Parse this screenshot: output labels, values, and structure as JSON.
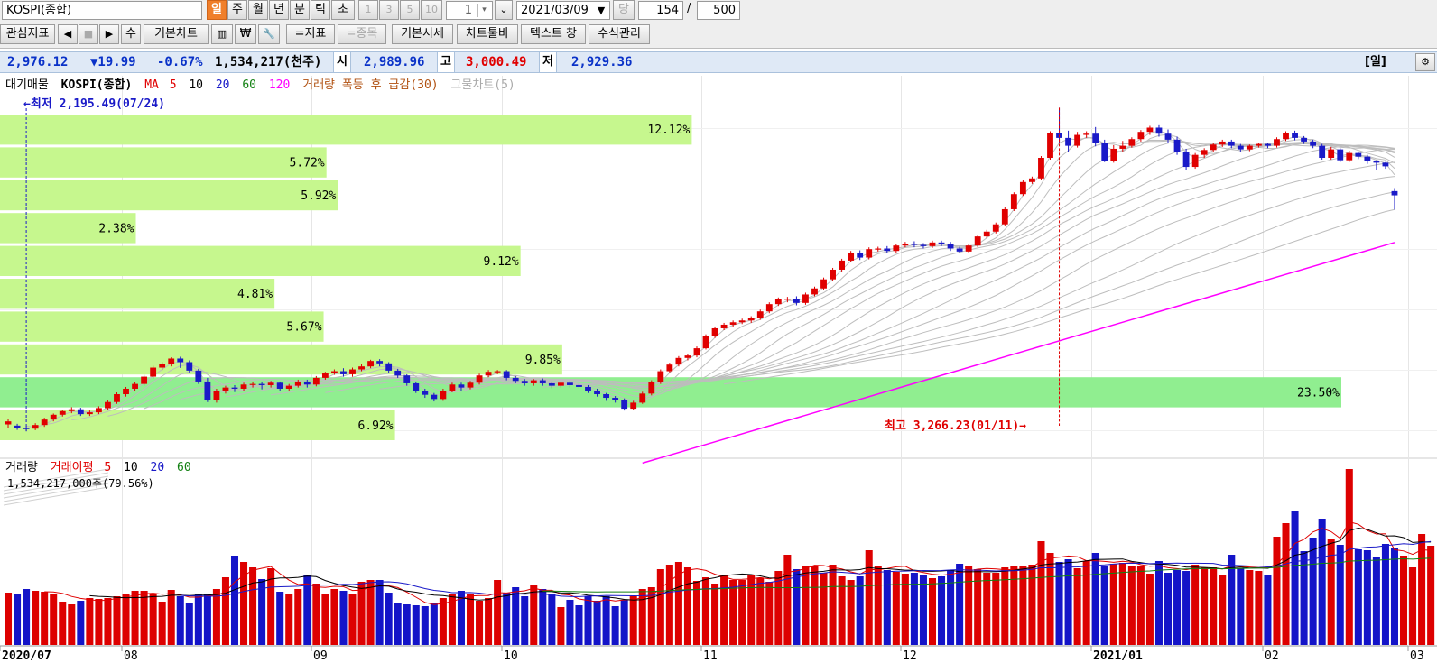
{
  "toolbar": {
    "symbol": "KOSPI(종합)",
    "periods": [
      "일",
      "주",
      "월",
      "년",
      "분",
      "틱",
      "초"
    ],
    "active_period": "일",
    "intervals": [
      "1",
      "3",
      "5",
      "10"
    ],
    "interval_value": "1",
    "date": "2021/03/09",
    "today_label": "당",
    "view_count": "154",
    "slash": "/",
    "total_count": "500",
    "row2": {
      "watch": "관심지표",
      "prev": "◀",
      "stop": "■",
      "next": "▶",
      "edit": "수",
      "basic_chart": "기본차트",
      "won": "₩",
      "wrench": "🔧",
      "indicator": "=지표",
      "item": "=종목",
      "basic_quote": "기본시세",
      "chart_toolbar": "차트툴바",
      "text_window": "텍스트 창",
      "formula": "수식관리"
    }
  },
  "infobar": {
    "price": "2,976.12",
    "change": "▼19.99",
    "change_pct": "-0.67%",
    "volume": "1,534,217(천주)",
    "open_label": "시",
    "open": "2,989.96",
    "high_label": "고",
    "high": "3,000.49",
    "low_label": "저",
    "low": "2,929.36",
    "period_label": "[일]"
  },
  "colors": {
    "up": "#e00000",
    "down": "#1a1ac8",
    "ma120": "#ff00ff",
    "profile": "#c6f78e",
    "profile_max": "#90ee90"
  },
  "price_legend": {
    "items": [
      "대기매물",
      "KOSPI(종합)",
      "MA",
      "5",
      "10",
      "20",
      "60",
      "120",
      "거래량 폭등 후 급감(30)",
      "그물차트(5)"
    ]
  },
  "volume_legend": {
    "items": [
      "거래량",
      "거래이평",
      "5",
      "10",
      "20",
      "60"
    ],
    "value": "1,534,217,000주(79.56%)"
  },
  "annotations": {
    "low": "←최저 2,195.49(07/24)",
    "high": "최고 3,266.23(01/11)→"
  },
  "chart_data": [
    {
      "type": "candlestick",
      "title": "KOSPI(종합)",
      "period": "daily",
      "last_date": "2021/03/09",
      "last": {
        "open": 2989.96,
        "high": 3000.49,
        "low": 2929.36,
        "close": 2976.12
      },
      "low_marker": {
        "value": 2195.49,
        "date": "07/24"
      },
      "high_marker": {
        "value": 3266.23,
        "date": "01/11"
      },
      "x_labels": [
        "2020/07",
        "08",
        "09",
        "10",
        "11",
        "12",
        "2021/01",
        "02",
        "03"
      ],
      "ylim": [
        2130,
        3300
      ],
      "candles": [
        [
          2218,
          2228,
          2205,
          2236
        ],
        [
          2214,
          2206,
          2200,
          2220
        ],
        [
          2206,
          2203,
          2195,
          2212
        ],
        [
          2204,
          2216,
          2199,
          2222
        ],
        [
          2216,
          2234,
          2210,
          2240
        ],
        [
          2234,
          2250,
          2228,
          2254
        ],
        [
          2250,
          2262,
          2244,
          2266
        ],
        [
          2262,
          2268,
          2255,
          2275
        ],
        [
          2268,
          2252,
          2246,
          2273
        ],
        [
          2252,
          2258,
          2246,
          2264
        ],
        [
          2258,
          2272,
          2252,
          2278
        ],
        [
          2272,
          2292,
          2266,
          2298
        ],
        [
          2292,
          2318,
          2286,
          2324
        ],
        [
          2318,
          2336,
          2310,
          2342
        ],
        [
          2336,
          2352,
          2328,
          2358
        ],
        [
          2352,
          2376,
          2346,
          2382
        ],
        [
          2376,
          2406,
          2370,
          2412
        ],
        [
          2406,
          2418,
          2398,
          2424
        ],
        [
          2418,
          2436,
          2410,
          2440
        ],
        [
          2436,
          2424,
          2405,
          2442
        ],
        [
          2424,
          2396,
          2390,
          2430
        ],
        [
          2396,
          2360,
          2352,
          2402
        ],
        [
          2360,
          2300,
          2292,
          2372
        ],
        [
          2300,
          2330,
          2290,
          2336
        ],
        [
          2330,
          2340,
          2320,
          2346
        ],
        [
          2340,
          2336,
          2325,
          2348
        ],
        [
          2336,
          2350,
          2330,
          2356
        ],
        [
          2350,
          2352,
          2340,
          2360
        ],
        [
          2352,
          2348,
          2334,
          2360
        ],
        [
          2348,
          2356,
          2340,
          2362
        ],
        [
          2356,
          2336,
          2330,
          2360
        ],
        [
          2336,
          2346,
          2330,
          2352
        ],
        [
          2346,
          2360,
          2340,
          2366
        ],
        [
          2360,
          2350,
          2340,
          2366
        ],
        [
          2350,
          2372,
          2344,
          2378
        ],
        [
          2372,
          2388,
          2366,
          2392
        ],
        [
          2388,
          2394,
          2382,
          2400
        ],
        [
          2394,
          2384,
          2376,
          2404
        ],
        [
          2384,
          2400,
          2376,
          2406
        ],
        [
          2400,
          2410,
          2394,
          2418
        ],
        [
          2410,
          2428,
          2404,
          2432
        ],
        [
          2428,
          2420,
          2410,
          2434
        ],
        [
          2420,
          2396,
          2388,
          2424
        ],
        [
          2396,
          2380,
          2372,
          2402
        ],
        [
          2380,
          2354,
          2346,
          2384
        ],
        [
          2354,
          2330,
          2322,
          2360
        ],
        [
          2330,
          2316,
          2306,
          2336
        ],
        [
          2316,
          2302,
          2294,
          2322
        ],
        [
          2302,
          2330,
          2296,
          2336
        ],
        [
          2330,
          2350,
          2324,
          2356
        ],
        [
          2350,
          2340,
          2330,
          2356
        ],
        [
          2340,
          2356,
          2334,
          2362
        ],
        [
          2356,
          2380,
          2350,
          2386
        ],
        [
          2380,
          2392,
          2374,
          2398
        ],
        [
          2392,
          2394,
          2384,
          2398
        ],
        [
          2394,
          2372,
          2364,
          2398
        ],
        [
          2372,
          2362,
          2354,
          2378
        ],
        [
          2362,
          2354,
          2346,
          2368
        ],
        [
          2354,
          2364,
          2346,
          2368
        ],
        [
          2364,
          2354,
          2346,
          2370
        ],
        [
          2354,
          2346,
          2338,
          2360
        ],
        [
          2346,
          2356,
          2340,
          2360
        ],
        [
          2356,
          2348,
          2340,
          2362
        ],
        [
          2348,
          2342,
          2336,
          2354
        ],
        [
          2342,
          2330,
          2322,
          2348
        ],
        [
          2330,
          2318,
          2310,
          2336
        ],
        [
          2318,
          2306,
          2296,
          2322
        ],
        [
          2306,
          2298,
          2290,
          2312
        ],
        [
          2298,
          2270,
          2264,
          2304
        ],
        [
          2270,
          2290,
          2266,
          2296
        ],
        [
          2290,
          2320,
          2286,
          2326
        ],
        [
          2320,
          2358,
          2314,
          2364
        ],
        [
          2358,
          2394,
          2352,
          2400
        ],
        [
          2394,
          2416,
          2388,
          2422
        ],
        [
          2416,
          2438,
          2410,
          2444
        ],
        [
          2438,
          2446,
          2430,
          2450
        ],
        [
          2446,
          2470,
          2440,
          2476
        ],
        [
          2470,
          2510,
          2466,
          2516
        ],
        [
          2510,
          2536,
          2504,
          2542
        ],
        [
          2536,
          2548,
          2530,
          2554
        ],
        [
          2548,
          2556,
          2540,
          2562
        ],
        [
          2556,
          2562,
          2550,
          2568
        ],
        [
          2562,
          2570,
          2554,
          2576
        ],
        [
          2570,
          2592,
          2564,
          2598
        ],
        [
          2592,
          2616,
          2586,
          2622
        ],
        [
          2616,
          2632,
          2610,
          2638
        ],
        [
          2632,
          2634,
          2622,
          2640
        ],
        [
          2634,
          2620,
          2612,
          2642
        ],
        [
          2620,
          2648,
          2614,
          2654
        ],
        [
          2648,
          2668,
          2642,
          2674
        ],
        [
          2668,
          2698,
          2662,
          2704
        ],
        [
          2698,
          2730,
          2692,
          2736
        ],
        [
          2730,
          2760,
          2724,
          2766
        ],
        [
          2760,
          2786,
          2754,
          2792
        ],
        [
          2786,
          2770,
          2762,
          2794
        ],
        [
          2770,
          2798,
          2764,
          2804
        ],
        [
          2798,
          2800,
          2790,
          2806
        ],
        [
          2800,
          2792,
          2784,
          2808
        ],
        [
          2792,
          2810,
          2786,
          2816
        ],
        [
          2810,
          2816,
          2804,
          2822
        ],
        [
          2816,
          2812,
          2804,
          2824
        ],
        [
          2812,
          2808,
          2800,
          2818
        ],
        [
          2808,
          2820,
          2802,
          2826
        ],
        [
          2820,
          2816,
          2808,
          2826
        ],
        [
          2816,
          2800,
          2792,
          2822
        ],
        [
          2800,
          2790,
          2784,
          2806
        ],
        [
          2790,
          2810,
          2784,
          2816
        ],
        [
          2810,
          2840,
          2804,
          2846
        ],
        [
          2840,
          2856,
          2834,
          2862
        ],
        [
          2856,
          2880,
          2850,
          2886
        ],
        [
          2880,
          2930,
          2874,
          2936
        ],
        [
          2930,
          2980,
          2924,
          2986
        ],
        [
          2980,
          3020,
          2974,
          3026
        ],
        [
          3020,
          3032,
          3014,
          3038
        ],
        [
          3032,
          3100,
          3026,
          3106
        ],
        [
          3100,
          3182,
          3094,
          3188
        ],
        [
          3182,
          3166,
          3150,
          3266
        ],
        [
          3166,
          3140,
          3120,
          3190
        ],
        [
          3140,
          3176,
          3134,
          3186
        ],
        [
          3176,
          3180,
          3166,
          3188
        ],
        [
          3180,
          3150,
          3138,
          3202
        ],
        [
          3150,
          3090,
          3086,
          3160
        ],
        [
          3090,
          3130,
          3084,
          3142
        ],
        [
          3130,
          3140,
          3120,
          3156
        ],
        [
          3140,
          3162,
          3134,
          3168
        ],
        [
          3162,
          3186,
          3154,
          3192
        ],
        [
          3186,
          3200,
          3176,
          3206
        ],
        [
          3200,
          3180,
          3170,
          3208
        ],
        [
          3180,
          3160,
          3150,
          3194
        ],
        [
          3160,
          3120,
          3110,
          3170
        ],
        [
          3120,
          3070,
          3060,
          3130
        ],
        [
          3070,
          3110,
          3064,
          3116
        ],
        [
          3110,
          3126,
          3100,
          3132
        ],
        [
          3126,
          3144,
          3120,
          3150
        ],
        [
          3144,
          3154,
          3136,
          3160
        ],
        [
          3154,
          3140,
          3132,
          3160
        ],
        [
          3140,
          3128,
          3120,
          3146
        ],
        [
          3128,
          3140,
          3122,
          3144
        ],
        [
          3140,
          3146,
          3134,
          3150
        ],
        [
          3146,
          3140,
          3132,
          3150
        ],
        [
          3140,
          3162,
          3134,
          3168
        ],
        [
          3162,
          3182,
          3156,
          3188
        ],
        [
          3182,
          3166,
          3158,
          3190
        ],
        [
          3166,
          3154,
          3146,
          3172
        ],
        [
          3154,
          3140,
          3132,
          3160
        ],
        [
          3140,
          3100,
          3094,
          3146
        ],
        [
          3100,
          3128,
          3094,
          3136
        ],
        [
          3128,
          3092,
          3086,
          3132
        ],
        [
          3092,
          3116,
          3086,
          3124
        ],
        [
          3116,
          3104,
          3096,
          3120
        ],
        [
          3104,
          3090,
          3080,
          3110
        ],
        [
          3090,
          3084,
          3060,
          3092
        ],
        [
          3084,
          3072,
          3064,
          3086
        ],
        [
          2990,
          2976,
          2929,
          3000
        ]
      ],
      "ma120": {
        "start": 2090,
        "end": 2820
      },
      "volume_profile": [
        {
          "label": "12.12%",
          "pct": 12.12
        },
        {
          "label": "5.72%",
          "pct": 5.72
        },
        {
          "label": "5.92%",
          "pct": 5.92
        },
        {
          "label": "2.38%",
          "pct": 2.38
        },
        {
          "label": "9.12%",
          "pct": 9.12
        },
        {
          "label": "4.81%",
          "pct": 4.81
        },
        {
          "label": "5.67%",
          "pct": 5.67
        },
        {
          "label": "9.85%",
          "pct": 9.85
        },
        {
          "label": "23.50%",
          "pct": 23.5
        },
        {
          "label": "6.92%",
          "pct": 6.92
        }
      ]
    },
    {
      "type": "bar",
      "title": "거래량",
      "ylim": [
        0,
        1900
      ],
      "volumes": [
        580,
        560,
        620,
        600,
        590,
        570,
        480,
        450,
        490,
        520,
        510,
        520,
        540,
        570,
        600,
        600,
        560,
        480,
        610,
        540,
        460,
        560,
        560,
        620,
        750,
        990,
        920,
        860,
        730,
        850,
        590,
        560,
        620,
        770,
        680,
        560,
        620,
        600,
        560,
        700,
        720,
        720,
        580,
        460,
        450,
        440,
        430,
        460,
        520,
        560,
        600,
        570,
        490,
        520,
        720,
        580,
        640,
        540,
        660,
        620,
        570,
        420,
        500,
        440,
        540,
        490,
        540,
        430,
        500,
        540,
        620,
        640,
        840,
        890,
        920,
        860,
        710,
        750,
        680,
        770,
        720,
        720,
        780,
        740,
        700,
        820,
        1000,
        840,
        880,
        880,
        800,
        890,
        760,
        720,
        760,
        1050,
        880,
        830,
        810,
        790,
        800,
        780,
        740,
        760,
        830,
        900,
        870,
        840,
        800,
        800,
        860,
        870,
        880,
        890,
        1150,
        1020,
        920,
        950,
        850,
        930,
        1020,
        880,
        900,
        910,
        880,
        880,
        790,
        930,
        800,
        830,
        820,
        890,
        860,
        860,
        780,
        1000,
        850,
        830,
        820,
        780,
        1200,
        1350,
        1480,
        1040,
        1190,
        1400,
        1170,
        1110,
        1950,
        1060,
        1050,
        980,
        1120,
        1070,
        990,
        860,
        1230,
        1100
      ]
    }
  ]
}
